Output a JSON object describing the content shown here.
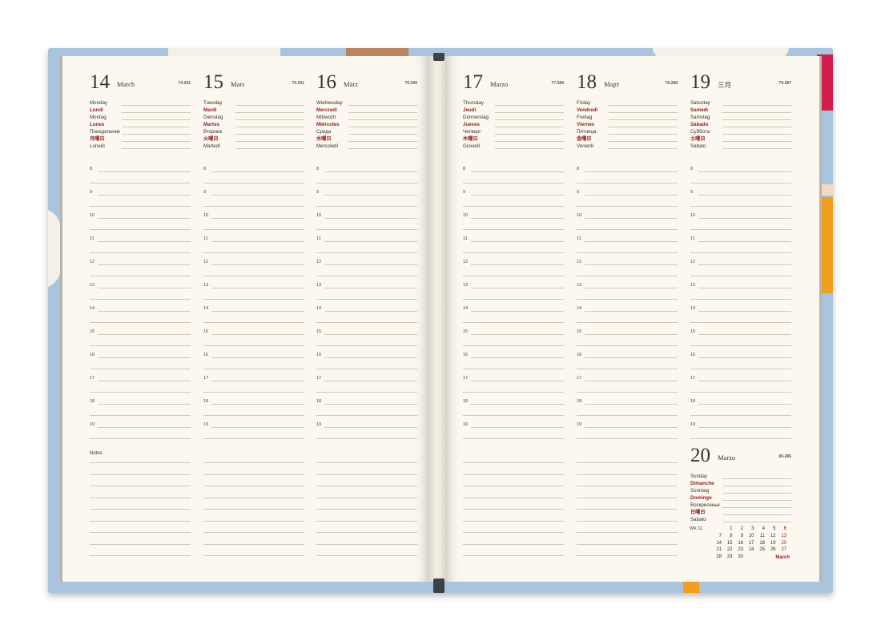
{
  "colors": {
    "cover": "#a9c4dc",
    "page": "#fdf8ef",
    "holiday_red": "#8e1c1c",
    "ribbon": "#3b4148"
  },
  "days": [
    {
      "num": "14",
      "month": "March",
      "code": "74-292",
      "names": [
        {
          "t": "Monday",
          "red": false
        },
        {
          "t": "Lundi",
          "red": true
        },
        {
          "t": "Montag",
          "red": false
        },
        {
          "t": "Lunes",
          "red": true
        },
        {
          "t": "Понедельник",
          "red": false
        },
        {
          "t": "月曜日",
          "red": true
        },
        {
          "t": "Lunedì",
          "red": false
        }
      ]
    },
    {
      "num": "15",
      "month": "Mars",
      "code": "75-291",
      "names": [
        {
          "t": "Tuesday",
          "red": false
        },
        {
          "t": "Mardi",
          "red": true
        },
        {
          "t": "Dienstag",
          "red": false
        },
        {
          "t": "Martes",
          "red": true
        },
        {
          "t": "Вторник",
          "red": false
        },
        {
          "t": "火曜日",
          "red": true
        },
        {
          "t": "Martedì",
          "red": false
        }
      ]
    },
    {
      "num": "16",
      "month": "März",
      "code": "76-290",
      "names": [
        {
          "t": "Wednesday",
          "red": false
        },
        {
          "t": "Mercredi",
          "red": true
        },
        {
          "t": "Mittwoch",
          "red": false
        },
        {
          "t": "Miércoles",
          "red": true
        },
        {
          "t": "Среда",
          "red": false
        },
        {
          "t": "水曜日",
          "red": true
        },
        {
          "t": "Mercoledì",
          "red": false
        }
      ]
    },
    {
      "num": "17",
      "month": "Marzo",
      "code": "77-289",
      "names": [
        {
          "t": "Thursday",
          "red": false
        },
        {
          "t": "Jeudi",
          "red": true
        },
        {
          "t": "Donnerstag",
          "red": false
        },
        {
          "t": "Jueves",
          "red": true
        },
        {
          "t": "Четверг",
          "red": false
        },
        {
          "t": "木曜日",
          "red": true
        },
        {
          "t": "Giovedì",
          "red": false
        }
      ]
    },
    {
      "num": "18",
      "month": "Март",
      "code": "78-288",
      "names": [
        {
          "t": "Friday",
          "red": false
        },
        {
          "t": "Vendredi",
          "red": true
        },
        {
          "t": "Freitag",
          "red": false
        },
        {
          "t": "Viernes",
          "red": true
        },
        {
          "t": "Пятница",
          "red": false
        },
        {
          "t": "金曜日",
          "red": true
        },
        {
          "t": "Venerdì",
          "red": false
        }
      ]
    },
    {
      "num": "19",
      "month": "三月",
      "code": "79-287",
      "names": [
        {
          "t": "Saturday",
          "red": false
        },
        {
          "t": "Samedi",
          "red": true
        },
        {
          "t": "Samstag",
          "red": false
        },
        {
          "t": "Sábado",
          "red": true
        },
        {
          "t": "Суббота",
          "red": false
        },
        {
          "t": "土曜日",
          "red": true
        },
        {
          "t": "Sabato",
          "red": false
        }
      ]
    }
  ],
  "sunday": {
    "num": "20",
    "month": "Marzo",
    "code": "80-286",
    "names": [
      {
        "t": "Sunday",
        "red": false
      },
      {
        "t": "Dimanche",
        "red": true
      },
      {
        "t": "Sonntag",
        "red": false
      },
      {
        "t": "Domingo",
        "red": true
      },
      {
        "t": "Воскресенье",
        "red": false
      },
      {
        "t": "日曜日",
        "red": true
      },
      {
        "t": "Sabato",
        "red": false
      }
    ]
  },
  "hours": [
    "8",
    "9",
    "10",
    "11",
    "12",
    "13",
    "14",
    "15",
    "16",
    "17",
    "18",
    "19"
  ],
  "notes_label": "Notes",
  "minical": {
    "wk_label": "WK 11",
    "rows": [
      [
        "",
        "1",
        "2",
        "3",
        "4",
        "5",
        "6"
      ],
      [
        "7",
        "8",
        "9",
        "10",
        "11",
        "12",
        "13"
      ],
      [
        "14",
        "15",
        "16",
        "17",
        "18",
        "19",
        "20"
      ],
      [
        "21",
        "22",
        "23",
        "24",
        "25",
        "26",
        "27"
      ],
      [
        "28",
        "29",
        "30",
        "",
        "",
        "",
        ""
      ]
    ],
    "month": "March"
  }
}
